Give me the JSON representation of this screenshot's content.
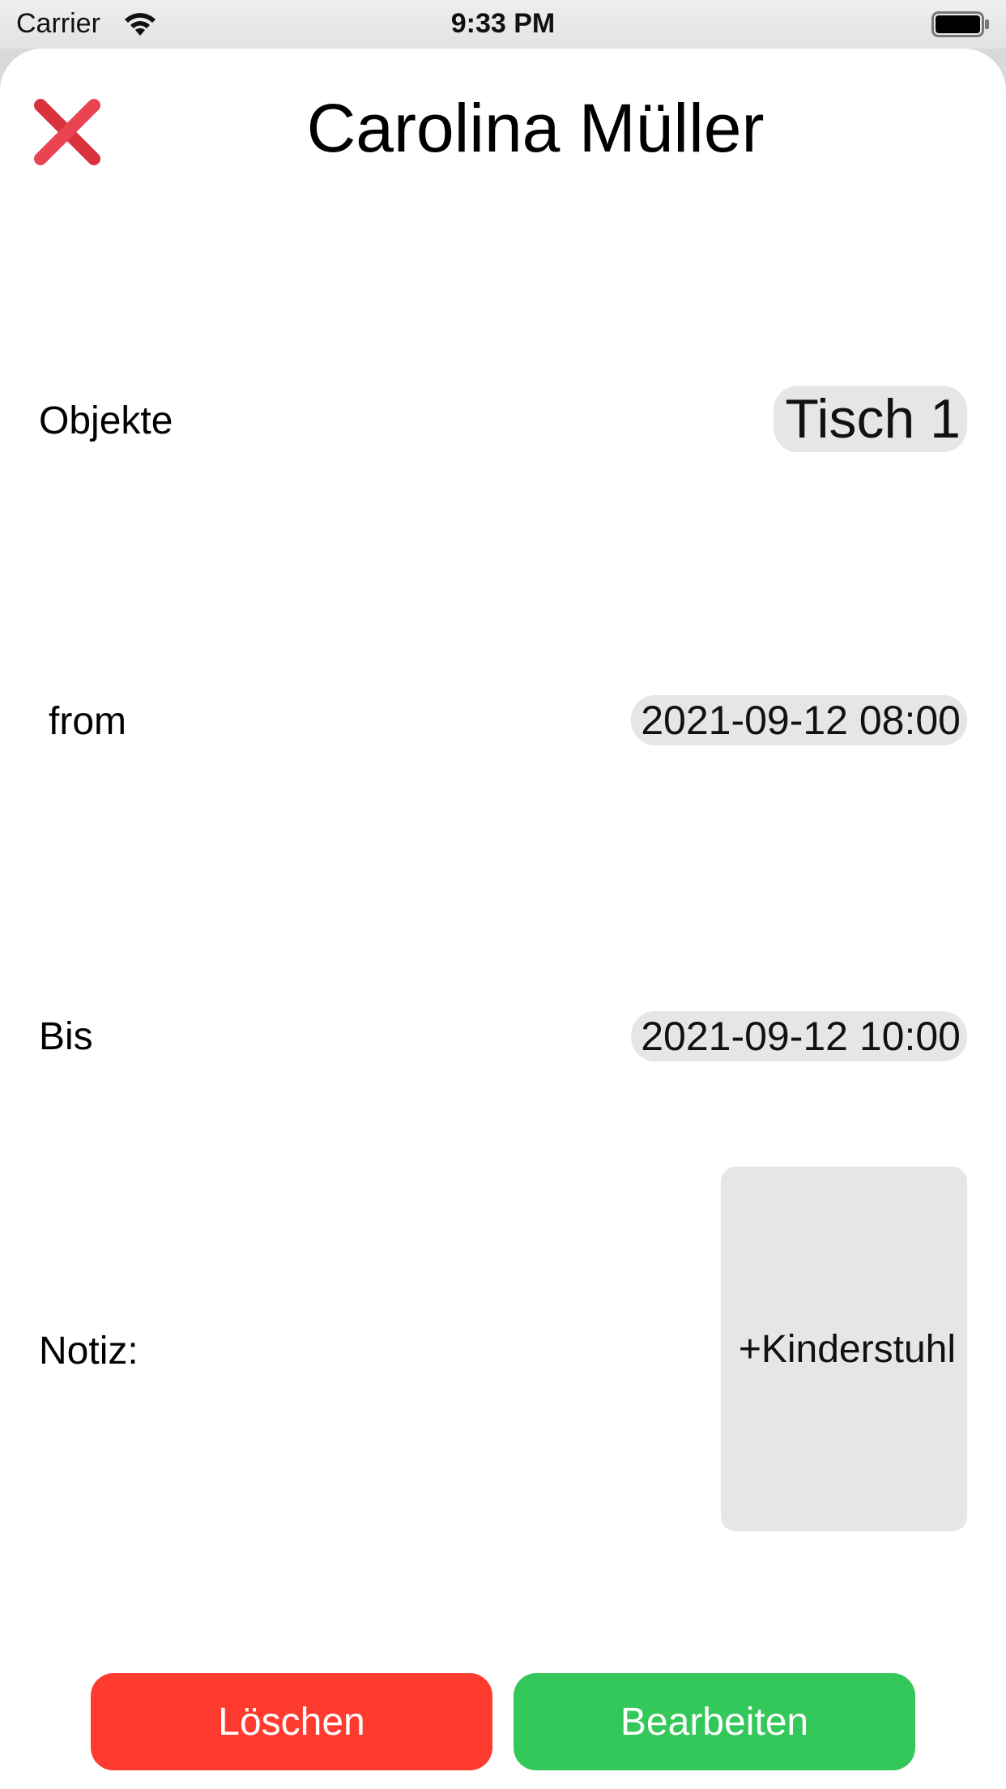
{
  "status_bar": {
    "carrier": "Carrier",
    "time": "9:33 PM",
    "icons": [
      "wifi-icon",
      "battery-icon"
    ]
  },
  "header": {
    "title": "Carolina Müller",
    "close_icon": "close-icon",
    "close_color": "#d9313d"
  },
  "fields": {
    "objekte": {
      "label": "Objekte",
      "value": "Tisch 1"
    },
    "from": {
      "label": "from",
      "value": "2021-09-12 08:00"
    },
    "bis": {
      "label": "Bis",
      "value": "2021-09-12 10:00"
    },
    "notiz": {
      "label": "Notiz:",
      "value": "+Kinderstuhl"
    }
  },
  "actions": {
    "delete_label": "Löschen",
    "edit_label": "Bearbeiten",
    "delete_color": "#ff3b30",
    "edit_color": "#34c759"
  }
}
